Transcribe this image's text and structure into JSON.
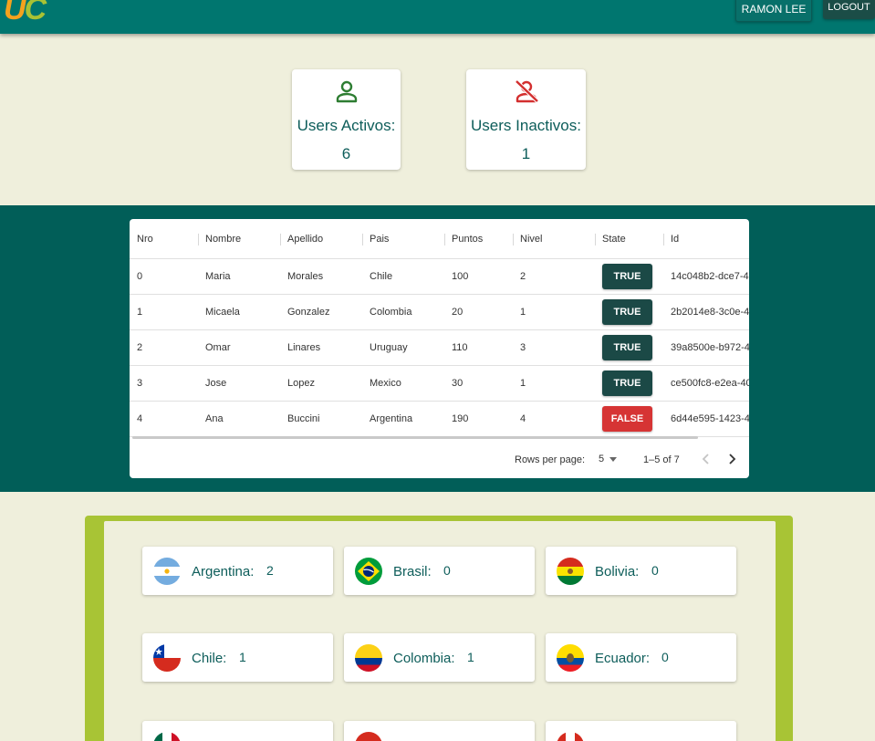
{
  "header": {
    "logo_u": "U",
    "logo_c": "C",
    "user_name": "RAMON LEE",
    "logout_label": "LOGOUT"
  },
  "stats": {
    "active": {
      "label": "Users Activos:",
      "value": "6",
      "icon": "person-icon",
      "color": "#2e7d32"
    },
    "inactive": {
      "label": "Users Inactivos:",
      "value": "1",
      "icon": "person-off-icon",
      "color": "#d32f2f"
    }
  },
  "table": {
    "columns": [
      "Nro",
      "Nombre",
      "Apellido",
      "Pais",
      "Puntos",
      "Nivel",
      "State",
      "Id"
    ],
    "rows": [
      {
        "nro": "0",
        "nombre": "Maria",
        "apellido": "Morales",
        "pais": "Chile",
        "puntos": "100",
        "nivel": "2",
        "state": "TRUE",
        "id": "14c048b2-dce7-4"
      },
      {
        "nro": "1",
        "nombre": "Micaela",
        "apellido": "Gonzalez",
        "pais": "Colombia",
        "puntos": "20",
        "nivel": "1",
        "state": "TRUE",
        "id": "2b2014e8-3c0e-4"
      },
      {
        "nro": "2",
        "nombre": "Omar",
        "apellido": "Linares",
        "pais": "Uruguay",
        "puntos": "110",
        "nivel": "3",
        "state": "TRUE",
        "id": "39a8500e-b972-4"
      },
      {
        "nro": "3",
        "nombre": "Jose",
        "apellido": "Lopez",
        "pais": "Mexico",
        "puntos": "30",
        "nivel": "1",
        "state": "TRUE",
        "id": "ce500fc8-e2ea-40"
      },
      {
        "nro": "4",
        "nombre": "Ana",
        "apellido": "Buccini",
        "pais": "Argentina",
        "puntos": "190",
        "nivel": "4",
        "state": "FALSE",
        "id": "6d44e595-1423-4"
      }
    ],
    "pagination": {
      "rows_per_page_label": "Rows per page:",
      "rows_per_page_value": "5",
      "range": "1–5 of 7"
    }
  },
  "countries": [
    {
      "name": "Argentina:",
      "count": "2",
      "flag": "argentina-flag-icon"
    },
    {
      "name": "Brasil:",
      "count": "0",
      "flag": "brazil-flag-icon"
    },
    {
      "name": "Bolivia:",
      "count": "0",
      "flag": "bolivia-flag-icon"
    },
    {
      "name": "Chile:",
      "count": "1",
      "flag": "chile-flag-icon"
    },
    {
      "name": "Colombia:",
      "count": "1",
      "flag": "colombia-flag-icon"
    },
    {
      "name": "Ecuador:",
      "count": "0",
      "flag": "ecuador-flag-icon"
    }
  ],
  "colors": {
    "topbar": "#00766f",
    "band": "#015e58",
    "background": "#efefdc",
    "frame": "#a8c435",
    "true_badge": "#1b4946",
    "false_badge": "#d63434"
  }
}
